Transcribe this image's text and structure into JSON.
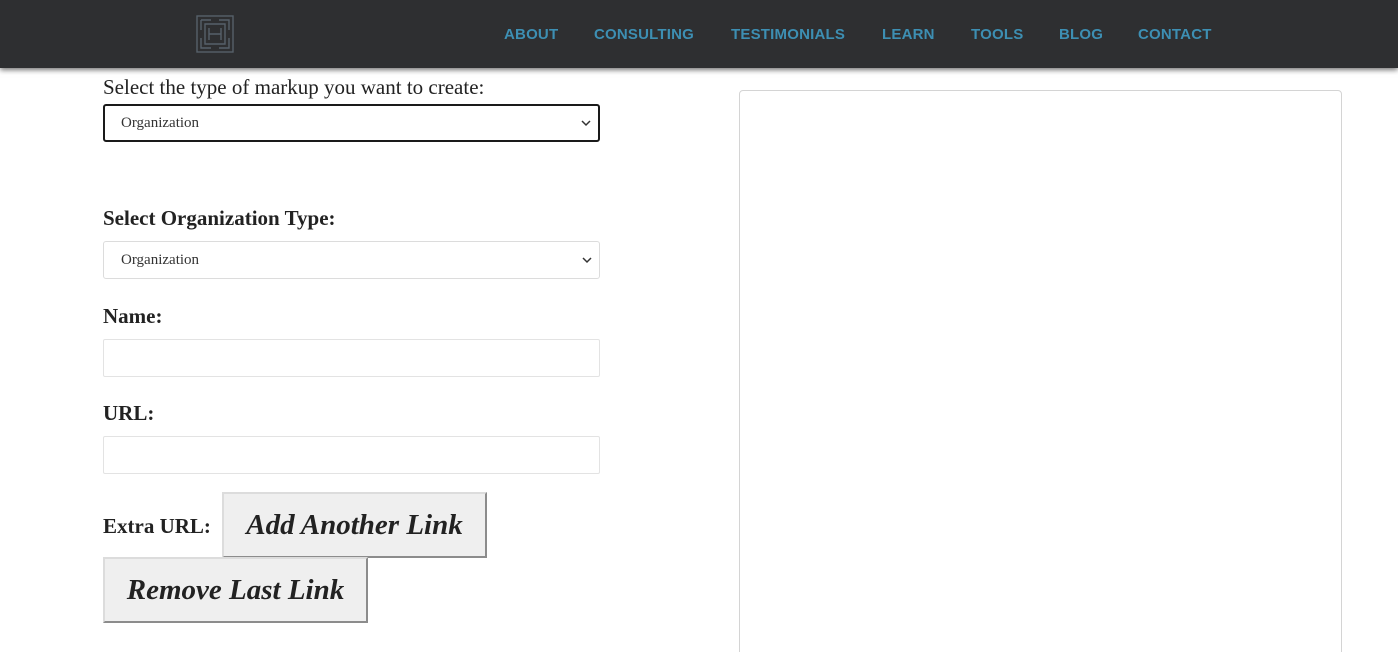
{
  "header": {
    "logo_icon": "maze-square-logo-icon",
    "nav_color": "#3d8fb3",
    "nav": [
      {
        "label": "ABOUT"
      },
      {
        "label": "CONSULTING"
      },
      {
        "label": "TESTIMONIALS"
      },
      {
        "label": "LEARN"
      },
      {
        "label": "TOOLS"
      },
      {
        "label": "BLOG"
      },
      {
        "label": "CONTACT"
      }
    ]
  },
  "form": {
    "markup_type_label": "Select the type of markup you want to create:",
    "markup_type_value": "Organization",
    "org_type_label": "Select Organization Type:",
    "org_type_value": "Organization",
    "name_label": "Name:",
    "name_value": "",
    "url_label": "URL:",
    "url_value": "",
    "extra_url_label": "Extra URL:",
    "add_link_button": "Add Another Link",
    "remove_link_button": "Remove Last Link"
  },
  "output": {
    "code": ""
  }
}
